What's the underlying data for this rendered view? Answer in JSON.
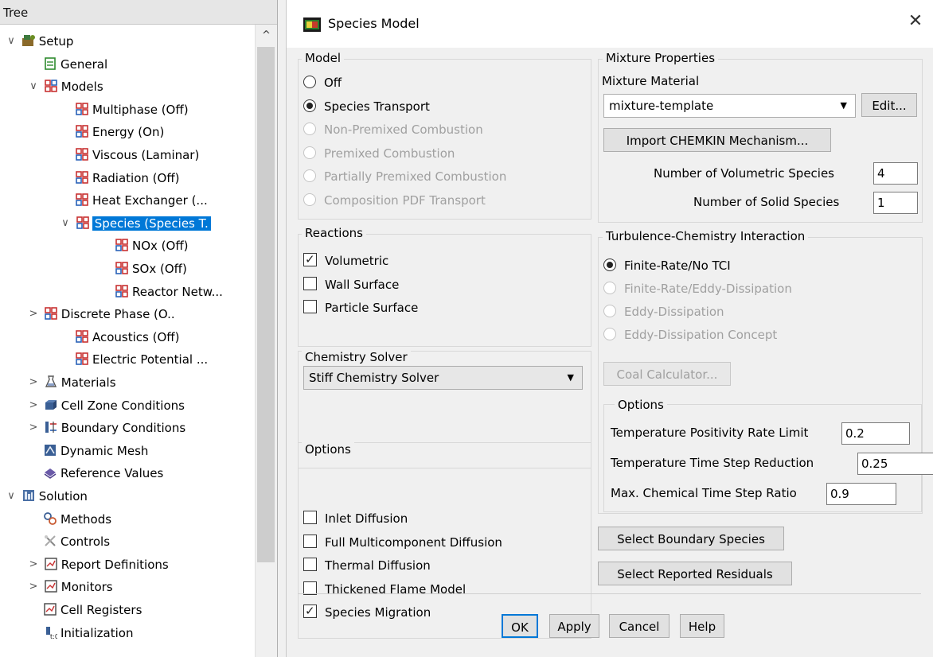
{
  "tree": {
    "header": "Tree",
    "items": [
      {
        "label": "Setup",
        "level": 0,
        "twisty": "open",
        "icon": "setup-icon"
      },
      {
        "label": "General",
        "level": 1,
        "twisty": "none",
        "icon": "general-icon"
      },
      {
        "label": "Models",
        "level": 1,
        "twisty": "open",
        "icon": "models-icon"
      },
      {
        "label": "Multiphase (Off)",
        "level": 2,
        "twisty": "none",
        "icon": "model-icon"
      },
      {
        "label": "Energy (On)",
        "level": 2,
        "twisty": "none",
        "icon": "model-icon"
      },
      {
        "label": "Viscous (Laminar)",
        "level": 2,
        "twisty": "none",
        "icon": "model-icon"
      },
      {
        "label": "Radiation (Off)",
        "level": 2,
        "twisty": "none",
        "icon": "model-icon"
      },
      {
        "label": "Heat Exchanger (...",
        "level": 2,
        "twisty": "none",
        "icon": "model-icon"
      },
      {
        "label": "Species (Species T.",
        "level": 2,
        "twisty": "open",
        "icon": "model-icon",
        "selected": true
      },
      {
        "label": "NOx (Off)",
        "level": 3,
        "twisty": "none",
        "icon": "model-icon"
      },
      {
        "label": "SOx (Off)",
        "level": 3,
        "twisty": "none",
        "icon": "model-icon"
      },
      {
        "label": "Reactor Netw...",
        "level": 3,
        "twisty": "none",
        "icon": "model-icon"
      },
      {
        "label": "Discrete Phase (O..",
        "level": 1,
        "twisty": "closed",
        "icon": "model-icon"
      },
      {
        "label": "Acoustics (Off)",
        "level": 2,
        "twisty": "none",
        "icon": "model-icon"
      },
      {
        "label": "Electric Potential ...",
        "level": 2,
        "twisty": "none",
        "icon": "model-icon"
      },
      {
        "label": "Materials",
        "level": 1,
        "twisty": "closed",
        "icon": "materials-icon"
      },
      {
        "label": "Cell Zone Conditions",
        "level": 1,
        "twisty": "closed",
        "icon": "cell-zone-icon"
      },
      {
        "label": "Boundary Conditions",
        "level": 1,
        "twisty": "closed",
        "icon": "boundary-icon"
      },
      {
        "label": "Dynamic Mesh",
        "level": 1,
        "twisty": "none",
        "icon": "dynamic-mesh-icon"
      },
      {
        "label": "Reference Values",
        "level": 1,
        "twisty": "none",
        "icon": "reference-icon"
      },
      {
        "label": "Solution",
        "level": 0,
        "twisty": "open",
        "icon": "solution-icon"
      },
      {
        "label": "Methods",
        "level": 1,
        "twisty": "none",
        "icon": "methods-icon"
      },
      {
        "label": "Controls",
        "level": 1,
        "twisty": "none",
        "icon": "controls-icon"
      },
      {
        "label": "Report Definitions",
        "level": 1,
        "twisty": "closed",
        "icon": "report-icon"
      },
      {
        "label": "Monitors",
        "level": 1,
        "twisty": "closed",
        "icon": "report-icon"
      },
      {
        "label": "Cell Registers",
        "level": 1,
        "twisty": "none",
        "icon": "report-icon"
      },
      {
        "label": "Initialization",
        "level": 1,
        "twisty": "none",
        "icon": "init-icon"
      }
    ]
  },
  "dialog": {
    "title": "Species Model",
    "model": {
      "title": "Model",
      "options": [
        {
          "label": "Off",
          "checked": false,
          "enabled": true
        },
        {
          "label": "Species Transport",
          "checked": true,
          "enabled": true
        },
        {
          "label": "Non-Premixed Combustion",
          "checked": false,
          "enabled": false
        },
        {
          "label": "Premixed Combustion",
          "checked": false,
          "enabled": false
        },
        {
          "label": "Partially Premixed Combustion",
          "checked": false,
          "enabled": false
        },
        {
          "label": "Composition PDF Transport",
          "checked": false,
          "enabled": false
        }
      ]
    },
    "reactions": {
      "title": "Reactions",
      "options": [
        {
          "label": "Volumetric",
          "checked": true
        },
        {
          "label": "Wall Surface",
          "checked": false
        },
        {
          "label": "Particle Surface",
          "checked": false
        }
      ]
    },
    "chemistry_solver": {
      "title": "Chemistry Solver",
      "value": "Stiff Chemistry Solver"
    },
    "options_left": {
      "title": "Options",
      "options": [
        {
          "label": "Inlet Diffusion",
          "checked": false
        },
        {
          "label": "Full Multicomponent Diffusion",
          "checked": false
        },
        {
          "label": "Thermal Diffusion",
          "checked": false
        },
        {
          "label": "Thickened Flame Model",
          "checked": false
        },
        {
          "label": "Species Migration",
          "checked": true
        }
      ]
    },
    "mixture": {
      "title": "Mixture Properties",
      "material_label": "Mixture Material",
      "material_value": "mixture-template",
      "edit_label": "Edit...",
      "import_label": "Import CHEMKIN Mechanism...",
      "vol_species_label": "Number of Volumetric Species",
      "vol_species_value": "4",
      "solid_species_label": "Number of Solid Species",
      "solid_species_value": "1"
    },
    "tci": {
      "title": "Turbulence-Chemistry Interaction",
      "options": [
        {
          "label": "Finite-Rate/No TCI",
          "checked": true,
          "enabled": true
        },
        {
          "label": "Finite-Rate/Eddy-Dissipation",
          "checked": false,
          "enabled": false
        },
        {
          "label": "Eddy-Dissipation",
          "checked": false,
          "enabled": false
        },
        {
          "label": "Eddy-Dissipation Concept",
          "checked": false,
          "enabled": false
        }
      ],
      "coal_calc_label": "Coal Calculator..."
    },
    "options_right": {
      "title": "Options",
      "rows": [
        {
          "label": "Temperature Positivity Rate Limit",
          "value": "0.2"
        },
        {
          "label": "Temperature Time Step Reduction",
          "value": "0.25"
        },
        {
          "label": "Max. Chemical Time Step Ratio",
          "value": "0.9"
        }
      ]
    },
    "select_boundary_label": "Select Boundary Species",
    "select_residuals_label": "Select Reported Residuals",
    "footer": {
      "ok": "OK",
      "apply": "Apply",
      "cancel": "Cancel",
      "help": "Help"
    }
  },
  "colors": {
    "selection": "#0078d7",
    "disabled_text": "#a0a0a0"
  }
}
